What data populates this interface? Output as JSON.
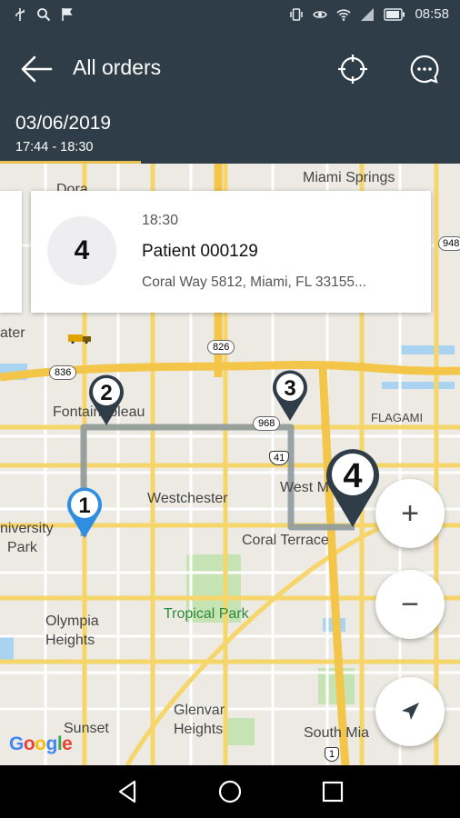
{
  "status_bar": {
    "time": "08:58",
    "left_icons": [
      "usb-icon",
      "search-icon",
      "flag-icon"
    ],
    "right_icons": [
      "vibrate-icon",
      "eye-icon",
      "wifi-icon",
      "signal-icon",
      "battery-icon"
    ]
  },
  "app_bar": {
    "title": "All orders",
    "back_icon": "arrow-left-icon",
    "locate_icon": "crosshair-icon",
    "chat_icon": "chat-bubble-icon",
    "background": "#2f3d48"
  },
  "tab": {
    "date": "03/06/2019",
    "time_range": "17:44 - 18:30",
    "indicator_color": "#e8c04d"
  },
  "order_card": {
    "number": "4",
    "time": "18:30",
    "patient": "Patient 000129",
    "address": "Coral Way 5812, Miami, FL 33155..."
  },
  "map": {
    "labels": {
      "miami_springs": "Miami Springs",
      "fontainebleau": "Fontainebleau",
      "flagami": "FLAGAMI",
      "westchester": "Westchester",
      "west_m": "West M",
      "coral_terrace": "Coral Terrace",
      "university": "niversity",
      "park": "Park",
      "olympia": "Olympia",
      "heights": "Heights",
      "tropical_park": "Tropical Park",
      "glenvar": "Glenvar",
      "glenvar_heights": "Heights",
      "sunset": "Sunset",
      "south_miami": "South Mia",
      "water": "ater",
      "dora": "Dora",
      "route_826": "826",
      "route_836": "836",
      "route_968": "968",
      "route_41": "41",
      "route_948": "948",
      "route_1": "1"
    },
    "markers": [
      "1",
      "2",
      "3",
      "4"
    ],
    "route_color": "#8e9aa0",
    "google_logo": [
      "G",
      "o",
      "o",
      "g",
      "l",
      "e"
    ]
  },
  "fabs": {
    "zoom_in": "+",
    "zoom_out": "−",
    "navigate_icon": "navigation-arrow-icon"
  },
  "nav_bar": {
    "back": "triangle-back-icon",
    "home": "circle-home-icon",
    "recents": "square-recents-icon"
  }
}
